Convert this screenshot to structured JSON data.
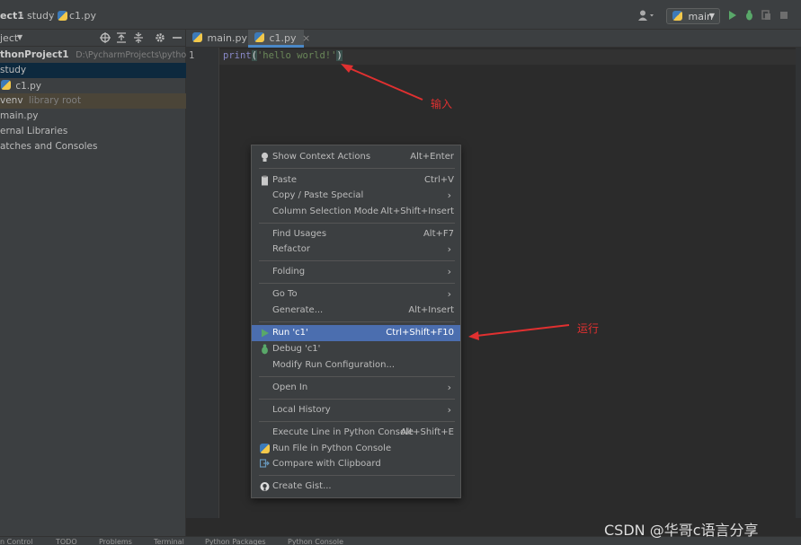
{
  "breadcrumb": {
    "project": "ect1",
    "folder": "study",
    "file": "c1.py"
  },
  "toolbar": {
    "run_config": "main",
    "run_config_icon": "python-icon"
  },
  "project_panel": {
    "title": "ject",
    "root_name": "thonProject1",
    "root_path": "D:\\PycharmProjects\\pythonProject",
    "items": [
      {
        "label": "study",
        "icon": "folder-icon"
      },
      {
        "label": "c1.py",
        "icon": "python-file-icon"
      },
      {
        "label": "venv",
        "note": "library root",
        "icon": "folder-icon"
      },
      {
        "label": "main.py",
        "icon": "python-file-icon"
      },
      {
        "label": "ernal Libraries",
        "icon": "library-icon"
      },
      {
        "label": "atches and Consoles",
        "icon": "console-icon"
      }
    ]
  },
  "editor": {
    "tabs": [
      {
        "label": "main.py"
      },
      {
        "label": "c1.py"
      }
    ],
    "line_number": "1",
    "code": {
      "fn": "print",
      "open": "(",
      "string": "'hello world!'",
      "close": ")"
    }
  },
  "context_menu": {
    "items": [
      {
        "label": "Show Context Actions",
        "shortcut": "Alt+Enter",
        "icon": "bulb-icon"
      },
      {
        "label": "Paste",
        "shortcut": "Ctrl+V",
        "icon": "clipboard-icon"
      },
      {
        "label": "Copy / Paste Special",
        "submenu": true
      },
      {
        "label": "Column Selection Mode",
        "shortcut": "Alt+Shift+Insert"
      },
      {
        "label": "Find Usages",
        "shortcut": "Alt+F7"
      },
      {
        "label": "Refactor",
        "submenu": true
      },
      {
        "label": "Folding",
        "submenu": true
      },
      {
        "label": "Go To",
        "submenu": true
      },
      {
        "label": "Generate...",
        "shortcut": "Alt+Insert"
      },
      {
        "label": "Run 'c1'",
        "shortcut": "Ctrl+Shift+F10",
        "icon": "run-icon",
        "highlighted": true
      },
      {
        "label": "Debug 'c1'",
        "icon": "debug-icon"
      },
      {
        "label": "Modify Run Configuration..."
      },
      {
        "label": "Open In",
        "submenu": true
      },
      {
        "label": "Local History",
        "submenu": true
      },
      {
        "label": "Execute Line in Python Console",
        "shortcut": "Alt+Shift+E"
      },
      {
        "label": "Run File in Python Console",
        "icon": "python-icon"
      },
      {
        "label": "Compare with Clipboard",
        "icon": "compare-icon"
      },
      {
        "label": "Create Gist...",
        "icon": "github-icon"
      }
    ]
  },
  "annotations": {
    "input_label": "输入",
    "run_label": "运行",
    "arrow_color": "#e03030"
  },
  "bottom_bar": {
    "items": [
      "n Control",
      "TODO",
      "Problems",
      "Terminal",
      "Python Packages",
      "Python Console"
    ]
  },
  "watermark": "CSDN @华哥c语言分享"
}
